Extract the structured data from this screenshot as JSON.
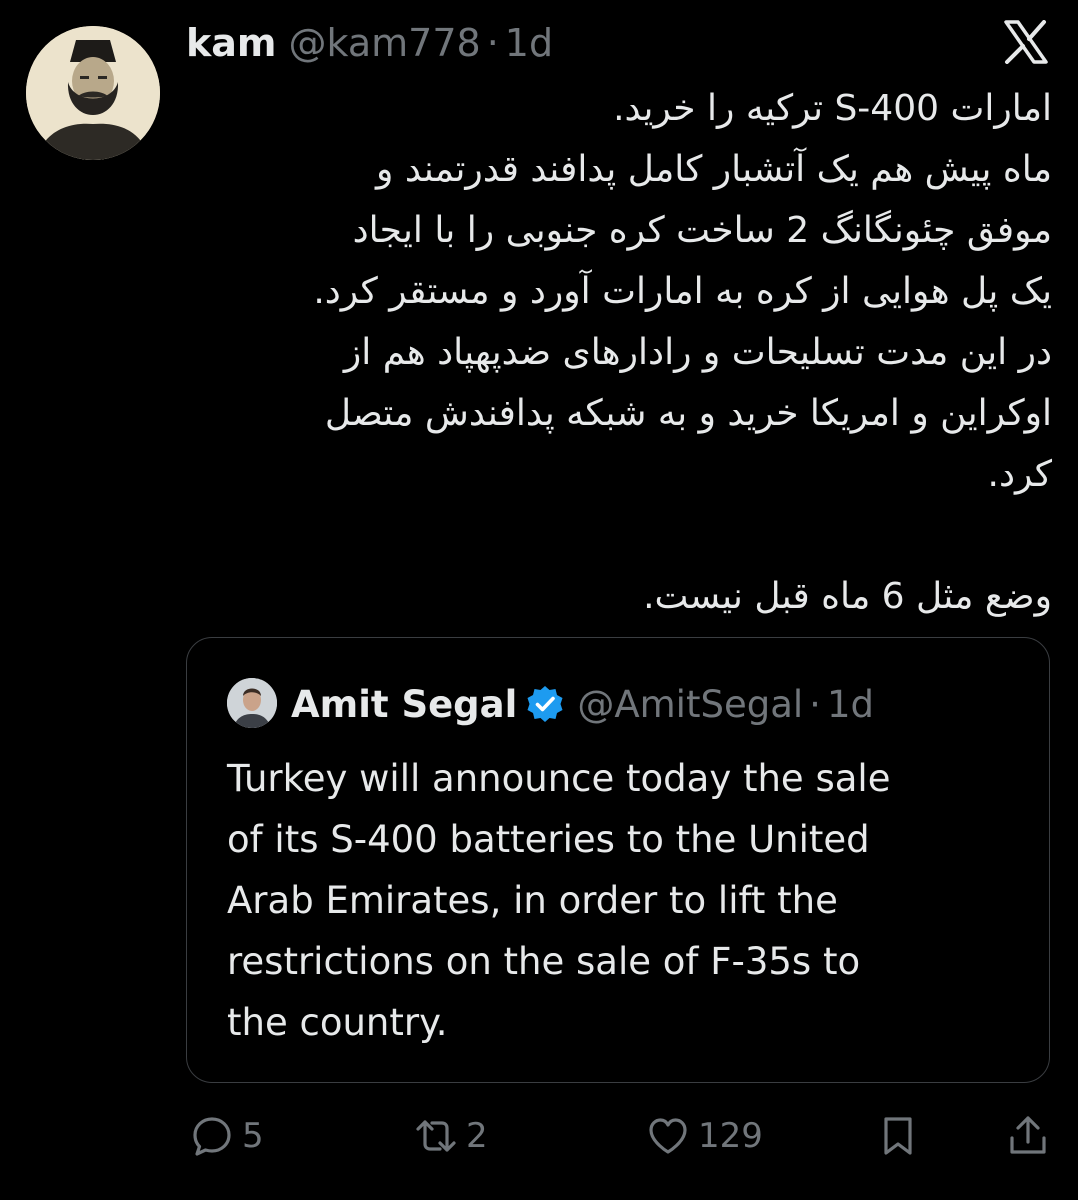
{
  "tweet": {
    "author": {
      "name": "kam",
      "handle": "@kam778",
      "time": "1d",
      "separator": "·"
    },
    "platform_icon": "x-logo-icon",
    "body_lines": [
      "امارات S-400 ترکیه را خرید.",
      "ماه پیش هم یک آتشبار کامل پدافند قدرتمند و",
      "موفق چئونگانگ 2 ساخت کره جنوبی را با ایجاد",
      "یک پل هوایی از کره به امارات آورد و مستقر کرد.",
      "در این مدت تسلیحات و رادارهای ضدپهپاد هم از",
      "اوکراین و امریکا خرید و به شبکه پدافندش متصل",
      "کرد.",
      "",
      "وضع مثل 6 ماه قبل نیست."
    ],
    "quoted": {
      "name": "Amit Segal",
      "verified": true,
      "handle": "@AmitSegal",
      "separator": "·",
      "time": "1d",
      "text_lines": [
        "Turkey will announce today the sale",
        "of its S-400 batteries to the United",
        "Arab Emirates, in order to lift the",
        "restrictions on the sale of F-35s to",
        "the country."
      ]
    },
    "actions": {
      "replies": "5",
      "reposts": "2",
      "likes": "129"
    }
  },
  "colors": {
    "background": "#000000",
    "text": "#e7e9ea",
    "muted": "#71767b",
    "border": "#3a3d41",
    "verified": "#1d9bf0"
  }
}
